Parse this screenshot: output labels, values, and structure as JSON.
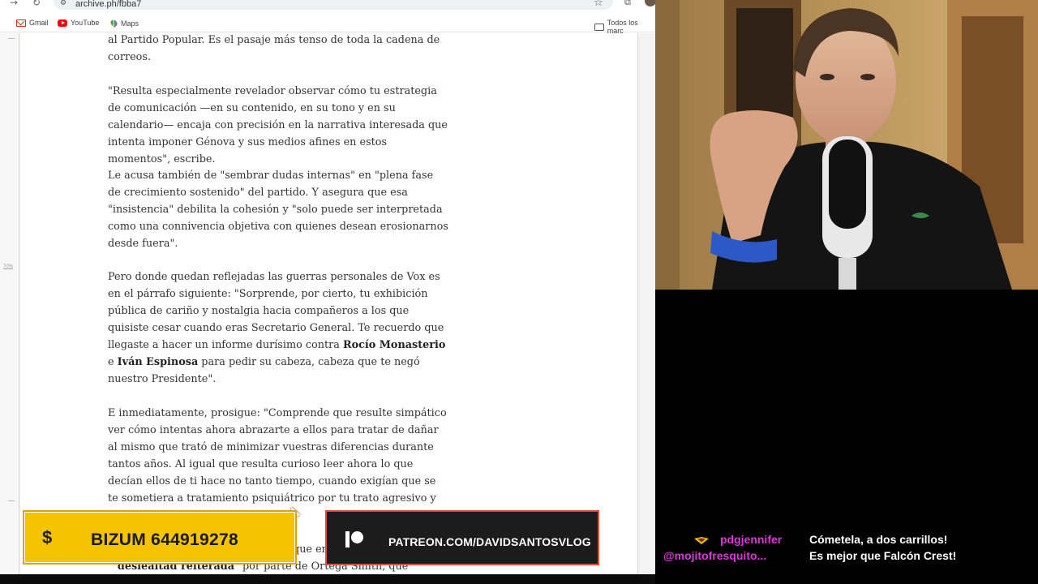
{
  "browser": {
    "url": "archive.ph/fbba7",
    "bookmarks": [
      {
        "label": "Gmail",
        "icon": "gmail-icon"
      },
      {
        "label": "YouTube",
        "icon": "youtube-icon"
      },
      {
        "label": "Maps",
        "icon": "maps-icon"
      }
    ],
    "bookmarks_folder": "Todos los marc",
    "rail_zoom_label": "70%"
  },
  "article": {
    "p1": "al Partido Popular. Es el pasaje más tenso de toda la cadena de correos.",
    "p2": "\"Resulta especialmente revelador observar cómo tu estrategia de comunicación —en su contenido, en su tono y en su calendario— encaja con precisión en la narrativa interesada que intenta imponer Génova y sus medios afines en estos momentos\", escribe.",
    "p3": "Le acusa también de \"sembrar dudas internas\" en \"plena fase de crecimiento sostenido\" del partido. Y asegura que esa \"insistencia\" debilita la cohesión y \"solo puede ser interpretada como una connivencia objetiva con quienes desean erosionarnos desde fuera\".",
    "p4_a": "Pero donde quedan reflejadas las guerras personales de Vox es en el párrafo siguiente: \"Sorprende, por cierto, tu exhibición pública de cariño y nostalgia hacia compañeros a los que quisiste cesar cuando eras Secretario General. Te recuerdo que llegaste a hacer un informe durísimo contra ",
    "p4_name1": "Rocío Monasterio",
    "p4_b": " e ",
    "p4_name2": "Iván Espinosa",
    "p4_c": " para pedir su cabeza, cabeza que te negó nuestro Presidente\".",
    "p5": "E inmediatamente, prosigue: \"Comprende que resulte simpático ver cómo intentas ahora abrazarte a ellos para tratar de dañar al mismo que trató de minimizar vuestras diferencias durante tantos años. Al igual que resulta curioso leer ahora lo que decían ellos de ti hace no tanto tiempo, cuando exigían que se te sometiera a tratamiento psiquiátrico por tu trato agresivo y violento con las",
    "p6_a": "que en",
    "p6_bold": "deslealtad reiterada",
    "p6_b": "\" por parte de Ortega Smith, que"
  },
  "banners": {
    "bizum_symbol": "$",
    "bizum_text": "BIZUM 644919278",
    "patreon_text": "PATREON.COM/DAVIDSANTOSVLOG"
  },
  "chat": {
    "messages": [
      {
        "user": "pdgjennifer",
        "text": "Cómetela, a dos carrillos!"
      },
      {
        "user": "@mojitofresquito...",
        "text": "Es mejor que Falcón Crest!"
      }
    ],
    "colors": {
      "username": "#d83bd4",
      "text": "#ffffff"
    }
  },
  "colors": {
    "bizum_bg": "#f4c400",
    "patreon_bg": "#1c1c1c",
    "patreon_border": "#e54b3a"
  }
}
